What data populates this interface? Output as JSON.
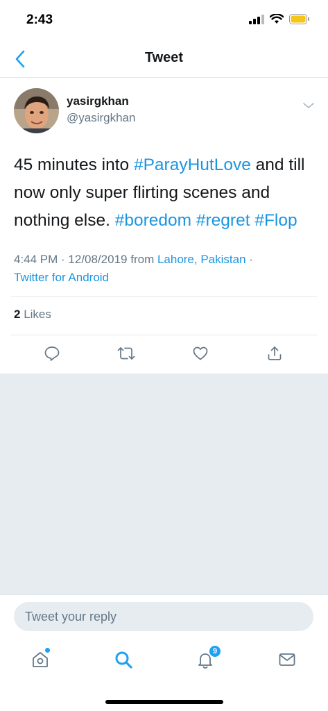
{
  "status_bar": {
    "time": "2:43",
    "signal_icon": "signal-icon",
    "wifi_icon": "wifi-icon",
    "battery_icon": "battery-icon",
    "battery_color": "#f5c518"
  },
  "nav": {
    "title": "Tweet",
    "back_icon": "back-chevron-icon"
  },
  "tweet": {
    "author_name": "yasirgkhan",
    "author_handle": "@yasirgkhan",
    "text_line1_plain": "45 minutes into ",
    "hashtag_paray": "#ParayHutLove",
    "text_line1_rest": " and till now only super flirting scenes and nothing else. ",
    "hashtag_boredom": "#boredom",
    "hashtag_regret": "#regret",
    "hashtag_flop": "#Flop",
    "timestamp": "4:44 PM · 12/08/2019 from ",
    "location": "Lahore, Pakistan",
    "separator": " ·",
    "source": "Twitter for Android",
    "likes_count": "2",
    "likes_label": "Likes"
  },
  "actions": [
    "reply-icon",
    "retweet-icon",
    "like-icon",
    "share-icon"
  ],
  "reply": {
    "placeholder": "Tweet your reply"
  },
  "tab_bar": {
    "notification_count": "9",
    "accent_color": "#1da1f2"
  }
}
